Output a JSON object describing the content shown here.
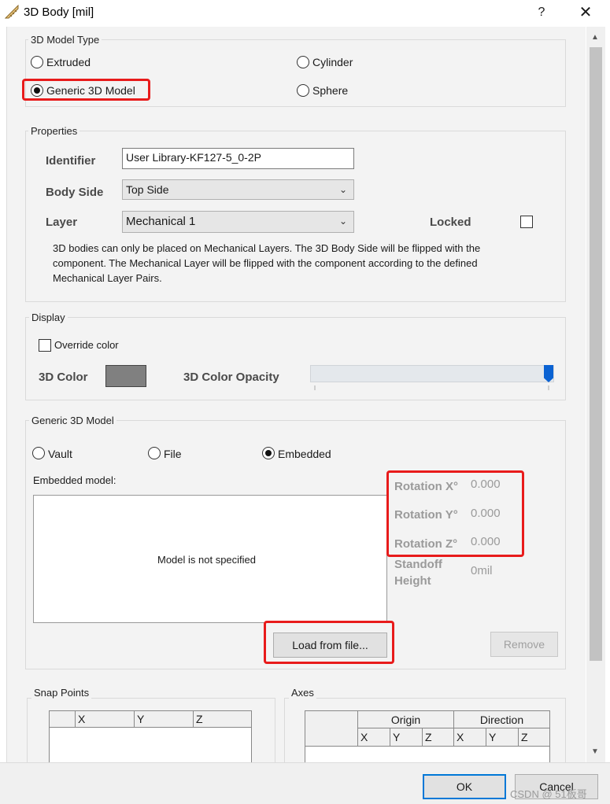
{
  "window": {
    "title": "3D Body [mil]",
    "help_label": "?",
    "close_label": "✕"
  },
  "model_type": {
    "title": "3D Model Type",
    "options": [
      "Extruded",
      "Cylinder",
      "Generic 3D Model",
      "Sphere"
    ],
    "selected": "Generic 3D Model"
  },
  "properties": {
    "title": "Properties",
    "identifier_label": "Identifier",
    "identifier_value": "User Library-KF127-5_0-2P",
    "body_side_label": "Body Side",
    "body_side_value": "Top Side",
    "layer_label": "Layer",
    "layer_value": "Mechanical 1",
    "locked_label": "Locked",
    "locked_checked": false,
    "note_line1": "3D bodies can only be placed on Mechanical Layers. The 3D Body Side will be flipped with the",
    "note_line2": "component. The Mechanical Layer will be flipped with the component according to the defined",
    "note_line3": "Mechanical Layer Pairs."
  },
  "display": {
    "title": "Display",
    "override_label": "Override color",
    "override_checked": false,
    "color_label": "3D Color",
    "color_value": "#808080",
    "opacity_label": "3D Color Opacity",
    "opacity_level": 1.0
  },
  "generic": {
    "title": "Generic 3D Model",
    "source_options": [
      "Vault",
      "File",
      "Embedded"
    ],
    "source_selected": "Embedded",
    "embedded_label": "Embedded model:",
    "model_status": "Model is not specified",
    "rotation_x_label": "Rotation X°",
    "rotation_x_value": "0.000",
    "rotation_y_label": "Rotation Y°",
    "rotation_y_value": "0.000",
    "rotation_z_label": "Rotation Z°",
    "rotation_z_value": "0.000",
    "standoff_label_1": "Standoff",
    "standoff_label_2": "Height",
    "standoff_value": "0mil",
    "load_button": "Load from file...",
    "remove_button": "Remove"
  },
  "snap_points": {
    "title": "Snap Points",
    "columns": [
      "X",
      "Y",
      "Z"
    ]
  },
  "axes": {
    "title": "Axes",
    "group_headers": [
      "Origin",
      "Direction"
    ],
    "columns": [
      "X",
      "Y",
      "Z",
      "X",
      "Y",
      "Z"
    ]
  },
  "footer": {
    "ok_label": "OK",
    "cancel_label": "Cancel",
    "watermark": "CSDN @ 51板哥"
  },
  "colors": {
    "highlight": "#e81b1b",
    "accent": "#0078d7",
    "slider": "#0b62d2"
  }
}
